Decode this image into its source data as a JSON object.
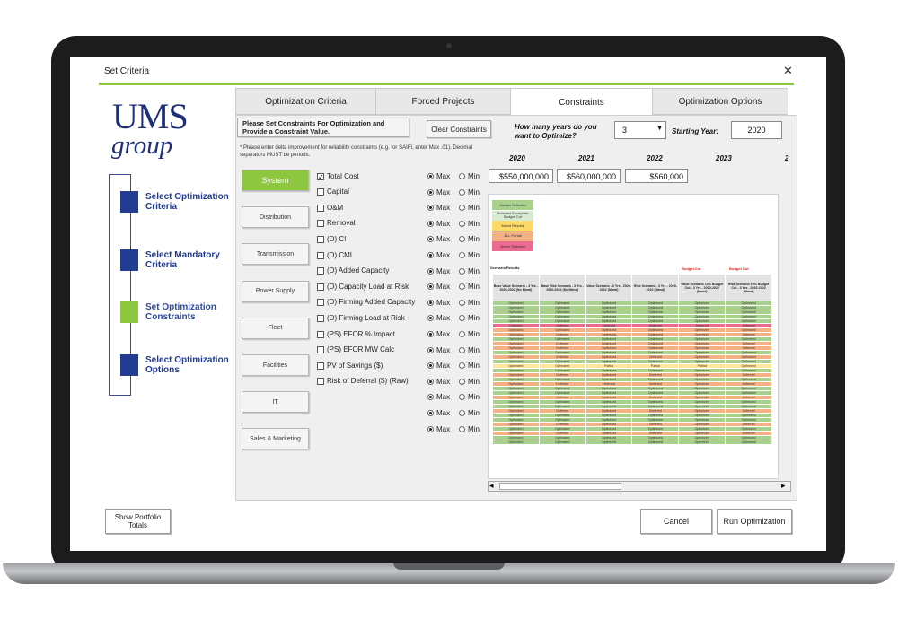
{
  "window": {
    "title": "Set Criteria",
    "close_glyph": "✕"
  },
  "logo": {
    "line1": "UMS",
    "line2": "group"
  },
  "steps": [
    {
      "label": "Select Optimization Criteria",
      "color": "#223c92"
    },
    {
      "label": "Select Mandatory Criteria",
      "color": "#223c92"
    },
    {
      "label": "Set Optimization Constraints",
      "color": "#8dc63f"
    },
    {
      "label": "Select Optimization Options",
      "color": "#223c92"
    }
  ],
  "tabs": [
    "Optimization Criteria",
    "Forced Projects",
    "Constraints",
    "Optimization Options"
  ],
  "active_tab": "Constraints",
  "constraints": {
    "instruction": "Please Set Constraints  For Optimization and Provide a Constraint Value.",
    "clear_label": "Clear Constraints",
    "note": "* Please enter delta improvement for reliability constraints (e.g. for SAIFI, enter Max .01).  Decimal separators MUST be periods.",
    "years_question": "How many years do you want to Optimize?",
    "years_value": "3",
    "dropdown_glyph": "▼",
    "start_label": "Starting Year:",
    "start_value": "2020",
    "year_headers": [
      "2020",
      "2021",
      "2022",
      "2023",
      "2"
    ],
    "value_inputs": [
      "$550,000,000",
      "$560,000,000",
      "$560,000"
    ]
  },
  "categories": [
    "System",
    "Distribution",
    "Transmission",
    "Power Supply",
    "Fleet",
    "Facilities",
    "IT",
    "Sales & Marketing"
  ],
  "selected_category": "System",
  "metrics": [
    {
      "label": "Total Cost",
      "checked": true
    },
    {
      "label": "Capital",
      "checked": false
    },
    {
      "label": "O&M",
      "checked": false
    },
    {
      "label": "Removal",
      "checked": false
    },
    {
      "label": "(D) CI",
      "checked": false
    },
    {
      "label": "(D) CMI",
      "checked": false
    },
    {
      "label": "(D) Added Capacity",
      "checked": false
    },
    {
      "label": "(D) Capacity Load at Risk",
      "checked": false
    },
    {
      "label": "(D) Firming Added Capacity",
      "checked": false
    },
    {
      "label": "(D) Firming Load at Risk",
      "checked": false
    },
    {
      "label": "(PS) EFOR % Impact",
      "checked": false
    },
    {
      "label": "(PS) EFOR MW Calc",
      "checked": false
    },
    {
      "label": "PV of Savings ($)",
      "checked": false
    },
    {
      "label": "Risk of Deferral ($) (Raw)",
      "checked": false
    }
  ],
  "radio": {
    "max_label": "Max",
    "min_label": "Min",
    "rows": 17,
    "selected": "Max"
  },
  "sheet": {
    "legend": [
      {
        "label": "Always Selected",
        "color": "#a9d18e"
      },
      {
        "label": "Selected Except for Budget Cut",
        "color": "#d9ead3"
      },
      {
        "label": "Mixed Results",
        "color": "#ffd966"
      },
      {
        "label": "ALL Partial",
        "color": "#f4b183"
      },
      {
        "label": "Never Selected",
        "color": "#ea6b8f"
      }
    ],
    "results_title": "Scenario Results",
    "budget_cut": "Budget Cut",
    "columns": [
      "Base Value Scenario - 3 Yrs - 2020-2022 (No Mand)",
      "Base Risk Scenario - 3 Yrs - 2020-2022 (No Mand)",
      "Value Scenario - 3 Yrs - 2020-2022 (Mand)",
      "Risk Scenario - 3 Yrs - 2020-2022 (Mand)",
      "Value Scenario 10% Budget Cut - 3 Yrs - 2020-2022 (Mand)",
      "Risk Scenario 10% Budget Cut - 3 Yrs - 2020-2022 (Mand)"
    ],
    "colors": {
      "green": "#a9d18e",
      "orange": "#f4b183",
      "yellow": "#ffe699",
      "pink": "#ea6b8f"
    },
    "rows": [
      {
        "c": "green",
        "v": [
          "Optimized",
          "Optimized",
          "Optimized",
          "Optimized",
          "Optimized",
          "Optimized"
        ]
      },
      {
        "c": "green",
        "v": [
          "Optimized",
          "Optimized",
          "Optimized",
          "Optimized",
          "Optimized",
          "Optimized"
        ]
      },
      {
        "c": "green",
        "v": [
          "Optimized",
          "Optimized",
          "Optimized",
          "Optimized",
          "Optimized",
          "Optimized"
        ]
      },
      {
        "c": "green",
        "v": [
          "Optimized",
          "Optimized",
          "Optimized",
          "Optimized",
          "Optimized",
          "Optimized"
        ]
      },
      {
        "c": "green",
        "v": [
          "Optimized",
          "Optimized",
          "Optimized",
          "Optimized",
          "Optimized",
          "Optimized"
        ]
      },
      {
        "c": "pink",
        "v": [
          "Deferred",
          "Deferred",
          "Deferred",
          "Deferred",
          "Deferred",
          "Deferred"
        ]
      },
      {
        "c": "orange",
        "v": [
          "Optimized",
          "Optimized",
          "Optimized",
          "Optimized",
          "Optimized",
          "Optimized"
        ]
      },
      {
        "c": "orange",
        "v": [
          "Optimized",
          "Deferred",
          "Optimized",
          "Optimized",
          "Optimized",
          "Deferred"
        ]
      },
      {
        "c": "green",
        "v": [
          "Optimized",
          "Optimized",
          "Optimized",
          "Optimized",
          "Optimized",
          "Optimized"
        ]
      },
      {
        "c": "orange",
        "v": [
          "Optimized",
          "Deferred",
          "Optimized",
          "Optimized",
          "Optimized",
          "Deferred"
        ]
      },
      {
        "c": "orange",
        "v": [
          "Optimized",
          "Deferred",
          "Optimized",
          "Optimized",
          "Optimized",
          "Deferred"
        ]
      },
      {
        "c": "green",
        "v": [
          "Optimized",
          "Optimized",
          "Optimized",
          "Optimized",
          "Optimized",
          "Optimized"
        ]
      },
      {
        "c": "orange",
        "v": [
          "Optimized",
          "Deferred",
          "Optimized",
          "Deferred",
          "Optimized",
          "Optimized"
        ]
      },
      {
        "c": "green",
        "v": [
          "Optimized",
          "Optimized",
          "Optimized",
          "Optimized",
          "Optimized",
          "Optimized"
        ]
      },
      {
        "c": "yellow",
        "v": [
          "Optimized",
          "Optimized",
          "Partial",
          "Partial",
          "Partial",
          "Optimized"
        ]
      },
      {
        "c": "green",
        "v": [
          "Optimized",
          "Optimized",
          "Optimized",
          "Optimized",
          "Optimized",
          "Optimized"
        ]
      },
      {
        "c": "orange",
        "v": [
          "Optimized",
          "Deferred",
          "Optimized",
          "Deferred",
          "Optimized",
          "Deferred"
        ]
      },
      {
        "c": "green",
        "v": [
          "Optimized",
          "Optimized",
          "Optimized",
          "Optimized",
          "Optimized",
          "Optimized"
        ]
      },
      {
        "c": "orange",
        "v": [
          "Optimized",
          "Deferred",
          "Deferred",
          "Deferred",
          "Optimized",
          "Deferred"
        ]
      },
      {
        "c": "green",
        "v": [
          "Optimized",
          "Optimized",
          "Optimized",
          "Optimized",
          "Optimized",
          "Optimized"
        ]
      },
      {
        "c": "green",
        "v": [
          "Optimized",
          "Optimized",
          "Optimized",
          "Optimized",
          "Optimized",
          "Optimized"
        ]
      },
      {
        "c": "orange",
        "v": [
          "Optimized",
          "Deferred",
          "Optimized",
          "Deferred",
          "Optimized",
          "Deferred"
        ]
      },
      {
        "c": "green",
        "v": [
          "Optimized",
          "Optimized",
          "Optimized",
          "Optimized",
          "Optimized",
          "Optimized"
        ]
      },
      {
        "c": "green",
        "v": [
          "Optimized",
          "Optimized",
          "Optimized",
          "Optimized",
          "Optimized",
          "Optimized"
        ]
      },
      {
        "c": "orange",
        "v": [
          "Optimized",
          "Deferred",
          "Optimized",
          "Deferred",
          "Optimized",
          "Deferred"
        ]
      },
      {
        "c": "green",
        "v": [
          "Optimized",
          "Optimized",
          "Optimized",
          "Optimized",
          "Optimized",
          "Optimized"
        ]
      },
      {
        "c": "green",
        "v": [
          "Optimized",
          "Optimized",
          "Optimized",
          "Optimized",
          "Optimized",
          "Optimized"
        ]
      },
      {
        "c": "orange",
        "v": [
          "Optimized",
          "Deferred",
          "Optimized",
          "Deferred",
          "Optimized",
          "Deferred"
        ]
      },
      {
        "c": "green",
        "v": [
          "Optimized",
          "Optimized",
          "Optimized",
          "Optimized",
          "Optimized",
          "Optimized"
        ]
      },
      {
        "c": "orange",
        "v": [
          "Optimized",
          "Deferred",
          "Optimized",
          "Deferred",
          "Optimized",
          "Deferred"
        ]
      },
      {
        "c": "green",
        "v": [
          "Optimized",
          "Optimized",
          "Optimized",
          "Optimized",
          "Optimized",
          "Optimized"
        ]
      },
      {
        "c": "green",
        "v": [
          "Optimized",
          "Optimized",
          "Optimized",
          "Optimized",
          "Optimized",
          "Optimized"
        ]
      }
    ]
  },
  "scroll": {
    "left": "◂",
    "right": "▸"
  },
  "footer": {
    "portfolio": "Show Portfolio Totals",
    "cancel": "Cancel",
    "run": "Run Optimization"
  }
}
